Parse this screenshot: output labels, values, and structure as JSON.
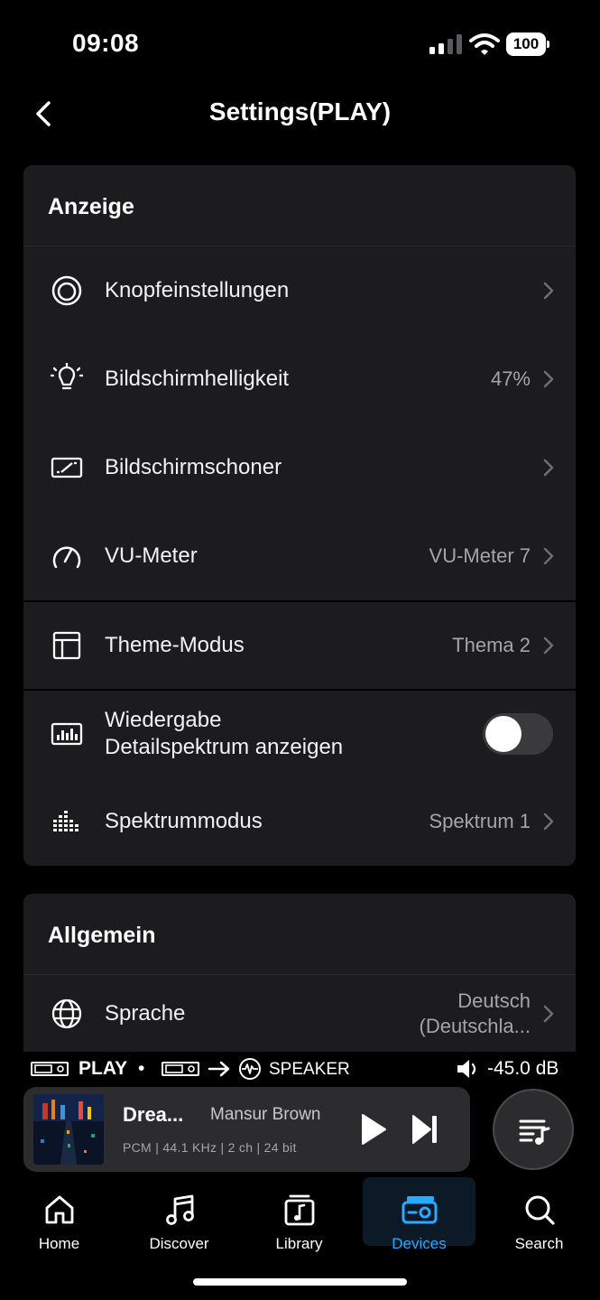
{
  "status_bar": {
    "time": "09:08",
    "battery": "100"
  },
  "header": {
    "title": "Settings(PLAY)"
  },
  "sections": {
    "display": {
      "title": "Anzeige",
      "knob": {
        "label": "Knopfeinstellungen"
      },
      "brightness": {
        "label": "Bildschirmhelligkeit",
        "value": "47%"
      },
      "screensaver": {
        "label": "Bildschirmschoner"
      },
      "vu": {
        "label": "VU-Meter",
        "value": "VU-Meter 7"
      },
      "theme": {
        "label": "Theme-Modus",
        "value": "Thema 2"
      },
      "spectrum_detail": {
        "label_line1": "Wiedergabe",
        "label_line2": "Detailspektrum anzeigen",
        "enabled": false
      },
      "spectrum_mode": {
        "label": "Spektrummodus",
        "value": "Spektrum 1"
      }
    },
    "general": {
      "title": "Allgemein",
      "language": {
        "label": "Sprache",
        "value_line1": "Deutsch",
        "value_line2": "(Deutschla..."
      }
    }
  },
  "route": {
    "source": "PLAY",
    "bullet": "•",
    "target": "SPEAKER",
    "volume": "-45.0 dB"
  },
  "player": {
    "title": "Drea...",
    "artist": "Mansur Brown",
    "format": "PCM | 44.1 KHz | 2 ch | 24 bit"
  },
  "tabs": [
    {
      "label": "Home"
    },
    {
      "label": "Discover"
    },
    {
      "label": "Library"
    },
    {
      "label": "Devices",
      "active": true
    },
    {
      "label": "Search"
    }
  ],
  "colors": {
    "accent": "#29a9ff",
    "card": "#1c1c1e",
    "secondary_text": "#a5a5a9"
  }
}
